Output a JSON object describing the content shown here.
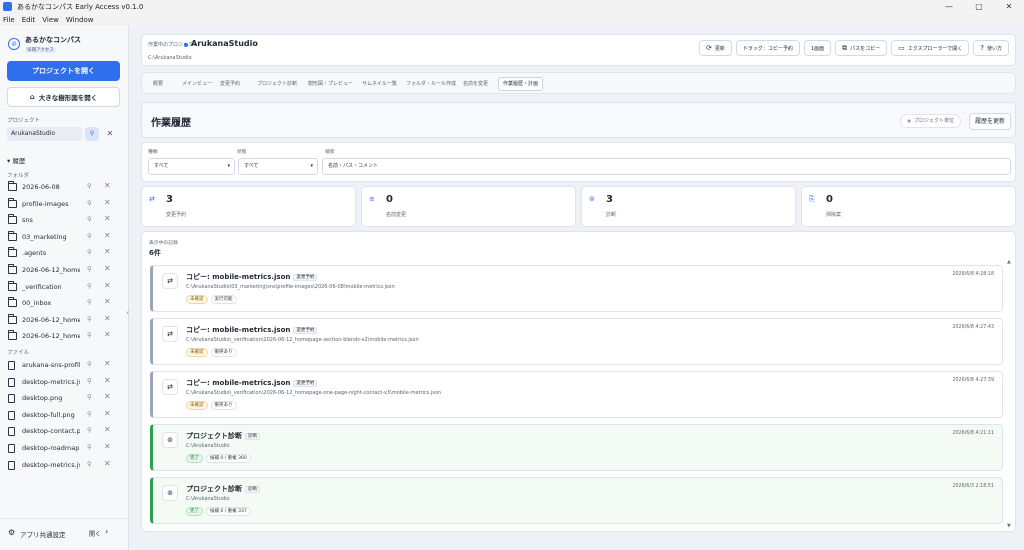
{
  "window": {
    "title": "あるかなコンパス Early Access v0.1.0",
    "controls": [
      "—",
      "▢",
      "✕"
    ]
  },
  "menu": [
    "File",
    "Edit",
    "View",
    "Window"
  ],
  "sidebar": {
    "app_name": "あるかなコンパス",
    "badge": "早期アクセス",
    "open_project": "プロジェクトを開く",
    "open_tree": "大きな樹形図を開く",
    "project_label": "プロジェクト",
    "project_value": "ArukanaStudio",
    "history_label": "▾ 履歴",
    "folders_label": "フォルダ",
    "files_label": "ファイル",
    "folders": [
      "2026-06-08",
      "profile-images",
      "sns",
      "03_marketing",
      ".agents",
      "2026-06-12_home...",
      "_verification",
      "00_inbox",
      "2026-06-12_home...",
      "2026-06-12_home..."
    ],
    "files": [
      "arukana-sns-profil...",
      "desktop-metrics.js...",
      "desktop.png",
      "desktop-full.png",
      "desktop-contact.p...",
      "desktop-roadmap...",
      "desktop-metrics.js..."
    ],
    "footer_label": "アプリ共通設定",
    "footer_open": "開く"
  },
  "project": {
    "label": "作業中のプロジェクト",
    "name": "ArukanaStudio",
    "path": "C:\\ArukanaStudio",
    "buttons": [
      {
        "icon": "⟳",
        "label": "更新"
      },
      {
        "icon": "",
        "label": "ドラッグ：コピー予約"
      },
      {
        "icon": "",
        "label": "1画面"
      },
      {
        "icon": "⧉",
        "label": "パスをコピー"
      },
      {
        "icon": "▭",
        "label": "エクスプローラーで開く"
      },
      {
        "icon": "?",
        "label": "使い方"
      }
    ]
  },
  "tabs": [
    "概要",
    "メインビュー",
    "変更予約",
    "プロジェクト診断",
    "樹形図・プレビュー",
    "サムネイル一覧",
    "フォルダ・ルール作成",
    "名前を変更",
    "作業履歴・計画"
  ],
  "history": {
    "title": "作業履歴",
    "scope": "プロジェクト単位",
    "refresh": "履歴を更新",
    "filter_type_label": "種類",
    "filter_type_value": "すべて",
    "filter_state_label": "状態",
    "filter_state_value": "すべて",
    "search_label": "検索",
    "search_placeholder": "名前・パス・コメント"
  },
  "stats": [
    {
      "icon": "⇄",
      "value": "3",
      "label": "変更予約"
    },
    {
      "icon": "≡",
      "value": "0",
      "label": "名前変更"
    },
    {
      "icon": "⊚",
      "value": "3",
      "label": "診断"
    },
    {
      "icon": "⎘",
      "value": "0",
      "label": "掃除案"
    }
  ],
  "list": {
    "caption": "表示中の記録",
    "count": "6件",
    "entries": [
      {
        "kind": "c",
        "icon": "⇄",
        "title": "コピー: mobile-metrics.json",
        "badge": "変更予約",
        "path": "C:\\ArukanaStudio\\03_marketing\\sns\\profile-images\\2026-06-08\\mobile-metrics.json",
        "tags": [
          {
            "t": "未確認",
            "s": "warn"
          },
          {
            "t": "実行可能",
            "s": ""
          }
        ],
        "ts": "2026/6/8 4:28:18"
      },
      {
        "kind": "c",
        "icon": "⇄",
        "title": "コピー: mobile-metrics.json",
        "badge": "変更予約",
        "path": "C:\\ArukanaStudio\\_verification\\2026-06-12_homepage-section-blends-v2\\mobile-metrics.json",
        "tags": [
          {
            "t": "未確認",
            "s": "warn"
          },
          {
            "t": "衝突あり",
            "s": ""
          }
        ],
        "ts": "2026/6/8 4:27:43"
      },
      {
        "kind": "c",
        "icon": "⇄",
        "title": "コピー: mobile-metrics.json",
        "badge": "変更予約",
        "path": "C:\\ArukanaStudio\\_verification\\2026-06-12_homepage-one-page-night-contact-v3\\mobile-metrics.json",
        "tags": [
          {
            "t": "未確認",
            "s": "warn"
          },
          {
            "t": "衝突あり",
            "s": ""
          }
        ],
        "ts": "2026/6/8 4:27:39"
      },
      {
        "kind": "d",
        "icon": "⊚",
        "title": "プロジェクト診断",
        "badge": "診断",
        "path": "C:\\ArukanaStudio",
        "tags": [
          {
            "t": "完了",
            "s": "ok"
          },
          {
            "t": "候補 0 / 重複 360",
            "s": ""
          }
        ],
        "ts": "2026/6/8 4:21:11"
      },
      {
        "kind": "d",
        "icon": "⊚",
        "title": "プロジェクト診断",
        "badge": "診断",
        "path": "C:\\ArukanaStudio",
        "tags": [
          {
            "t": "完了",
            "s": "ok"
          },
          {
            "t": "候補 0 / 重複 337",
            "s": ""
          }
        ],
        "ts": "2026/6/3 2:18:51"
      }
    ]
  }
}
